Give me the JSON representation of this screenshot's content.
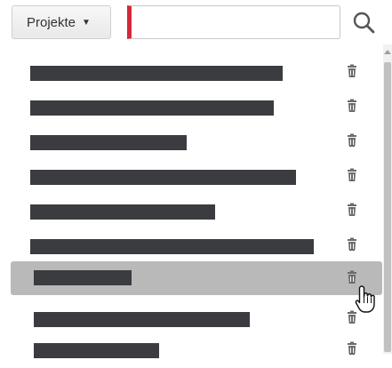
{
  "toolbar": {
    "dropdown_label": "Projekte",
    "dropdown_icon": "caret-down-icon",
    "search_value": "",
    "search_placeholder": "",
    "search_icon": "search-icon",
    "accent_color": "#d6283b"
  },
  "projects": {
    "row_icon": "trash-icon",
    "selected_index": 6,
    "items": [
      {
        "name": "",
        "redacted": true
      },
      {
        "name": "",
        "redacted": true
      },
      {
        "name": "",
        "redacted": true
      },
      {
        "name": "",
        "redacted": true
      },
      {
        "name": "",
        "redacted": true
      },
      {
        "name": "",
        "redacted": true
      },
      {
        "name": "",
        "redacted": true
      },
      {
        "name": "",
        "redacted": true
      },
      {
        "name": "",
        "redacted": true
      }
    ]
  },
  "colors": {
    "redaction_bar": "#3a3c3f",
    "selected_row": "#b9b9b9",
    "icon": "#6b6b6b"
  }
}
